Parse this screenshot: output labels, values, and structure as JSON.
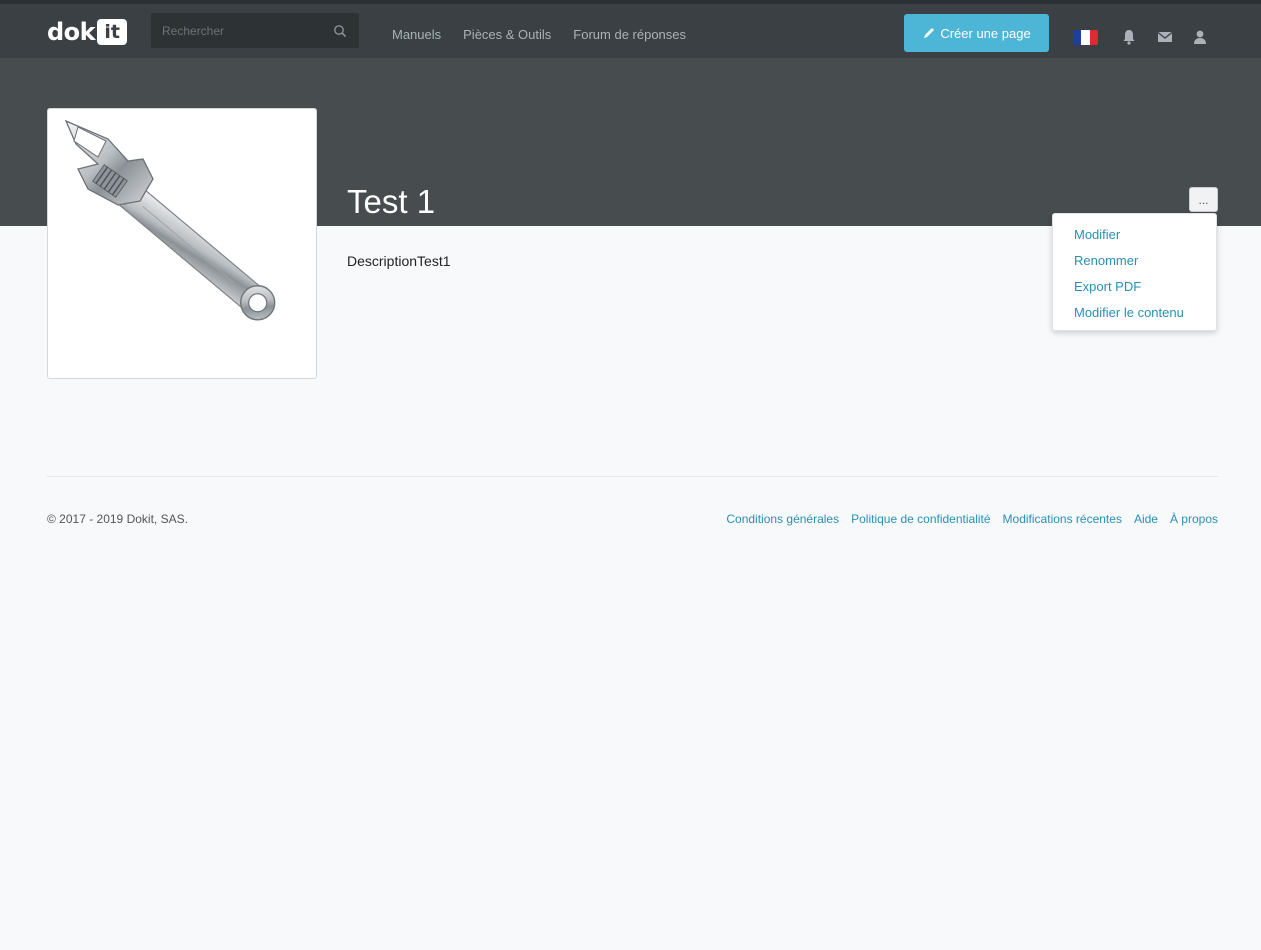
{
  "navbar": {
    "logo_text": "dok",
    "logo_box_text": "it",
    "search": {
      "placeholder": "Rechercher",
      "value": ""
    },
    "links": [
      "Manuels",
      "Pièces & Outils",
      "Forum de réponses"
    ],
    "create_button_label": "Créer une page",
    "icons": [
      "french-flag-icon",
      "bell-icon",
      "envelope-icon",
      "user-icon"
    ],
    "colors": {
      "background": "#3a4043",
      "accent": "#4db5d6"
    }
  },
  "page": {
    "title": "Test 1",
    "description": "DescriptionTest1",
    "image": "wrench-image",
    "more_button_label": "..."
  },
  "dropdown_menu": {
    "items": [
      "Modifier",
      "Renommer",
      "Export PDF",
      "Modifier le contenu"
    ]
  },
  "footer": {
    "copyright": "© 2017 - 2019 Dokit, SAS.",
    "links": [
      "Conditions générales",
      "Politique de confidentialité",
      "Modifications récentes",
      "Aide",
      "À propos"
    ]
  }
}
